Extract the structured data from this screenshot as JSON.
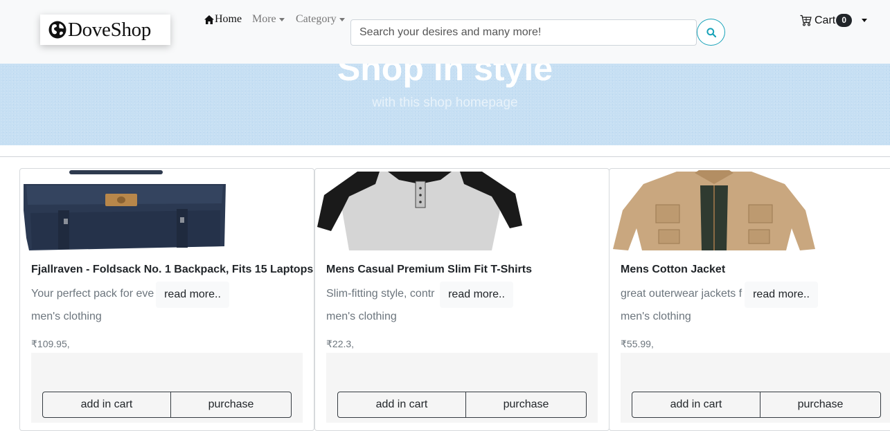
{
  "brand": {
    "name": "DoveShop"
  },
  "nav": {
    "home": "Home",
    "more": "More",
    "category": "Category"
  },
  "search": {
    "placeholder": "Search your desires and many more!"
  },
  "cart": {
    "label": "Cart",
    "count": "0"
  },
  "hero": {
    "title": "Shop in style",
    "subtitle": "with this shop homepage"
  },
  "products": [
    {
      "title": "Fjallraven - Foldsack No. 1 Backpack, Fits 15 Laptops",
      "desc": "Your perfect pack for eve",
      "read_more": "read more..",
      "category": "men's clothing",
      "price": "₹109.95,",
      "add_label": "add in cart",
      "buy_label": "purchase",
      "image": "backpack"
    },
    {
      "title": "Mens Casual Premium Slim Fit T-Shirts",
      "desc": "Slim-fitting style, contr",
      "read_more": "read more..",
      "category": "men's clothing",
      "price": "₹22.3,",
      "add_label": "add in cart",
      "buy_label": "purchase",
      "image": "raglan-t-shirt"
    },
    {
      "title": "Mens Cotton Jacket",
      "desc": "great outerwear jackets f",
      "read_more": "read more..",
      "category": "men's clothing",
      "price": "₹55.99,",
      "add_label": "add in cart",
      "buy_label": "purchase",
      "image": "cotton-jacket"
    }
  ],
  "colors": {
    "navbar_bg": "#f8f9fa",
    "hero_bg": "#c6dff3",
    "search_accent": "#17a2b8",
    "badge_bg": "#212529"
  }
}
